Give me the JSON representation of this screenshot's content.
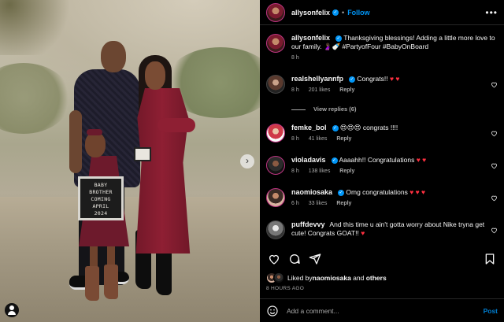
{
  "post": {
    "username": "allysonfelix",
    "follow_label": "Follow",
    "more_label": "•••",
    "caption_username": "allysonfelix",
    "caption_text": "Thanksgiving blessings! Adding a little more love to our family. 🤰🏾🍼 #PartyofFour #BabyOnBoard",
    "caption_time": "8 h",
    "letterboard_lines": [
      "BABY",
      "BROTHER",
      "COMING",
      "APRIL",
      "2024"
    ]
  },
  "comments": [
    {
      "username": "realshellyannfp",
      "verified": true,
      "text": "Congrats!! ♥ ♥",
      "time": "8 h",
      "likes": "201 likes",
      "reply": "Reply",
      "view_replies": "View replies (6)"
    },
    {
      "username": "femke_bol",
      "verified": true,
      "text": "😍😍😍 congrats !!!!",
      "time": "8 h",
      "likes": "41 likes",
      "reply": "Reply"
    },
    {
      "username": "violadavis",
      "verified": true,
      "text": "Aaaahh!! Congratulations ♥ ♥",
      "time": "8 h",
      "likes": "138 likes",
      "reply": "Reply"
    },
    {
      "username": "naomiosaka",
      "verified": true,
      "text": "Omg congratulations ♥ ♥ ♥",
      "time": "6 h",
      "likes": "33 likes",
      "reply": "Reply"
    },
    {
      "username": "puffdevvy",
      "verified": false,
      "text": "And this time u ain't gotta worry about Nike tryna get cute! Congrats GOAT!! ♥",
      "time": "",
      "likes": "",
      "reply": ""
    }
  ],
  "likes": {
    "prefix": "Liked by ",
    "user": "naomiosaka",
    "middle": " and ",
    "others": "others"
  },
  "timestamp": "8 HOURS AGO",
  "composer": {
    "placeholder": "Add a comment...",
    "post_label": "Post"
  },
  "colors": {
    "accent": "#0095f6",
    "heart": "#ff3040",
    "background": "#000000",
    "muted": "#a8a8a8"
  },
  "icons": [
    "heart-icon",
    "comment-icon",
    "share-icon",
    "bookmark-icon",
    "emoji-icon",
    "verified-icon",
    "next-arrow-icon",
    "account-icon"
  ]
}
